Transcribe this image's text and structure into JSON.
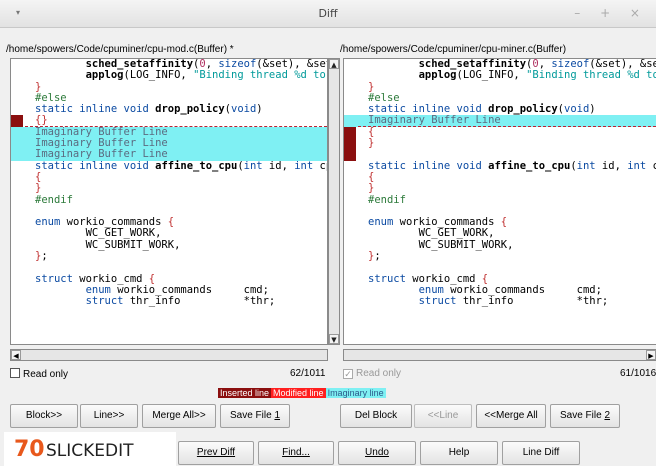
{
  "window": {
    "title": "Diff",
    "menu_glyph": "▾",
    "controls": "– + ×"
  },
  "left": {
    "path": "/home/spowers/Code/cpuminer/cpu-mod.c(Buffer) *",
    "status": "62/1011",
    "read_only_label": "Read only"
  },
  "right": {
    "path": "/home/spowers/Code/cpuminer/cpu-miner.c(Buffer)",
    "status": "61/1016",
    "read_only_label": "Read only"
  },
  "legend": {
    "inserted": "Inserted line",
    "modified": "Modified line",
    "imaginary": "Imaginary line"
  },
  "buttons_row1": {
    "block": "Block>>",
    "line": "Line>>",
    "merge_all": "Merge All>>",
    "save_file1_prefix": "Save File ",
    "save_file1_key": "1",
    "del_block": "Del Block",
    "line_back": "<<Line",
    "merge_all_back": "<<Merge All",
    "save_file2_prefix": "Save File ",
    "save_file2_key": "2"
  },
  "buttons_row2": {
    "prev_diff": "Prev Diff",
    "find": "Find...",
    "undo": "Undo",
    "help": "Help",
    "line_diff": "Line Diff"
  },
  "logo": {
    "number": "70",
    "name": "SLICKEDIT"
  },
  "colors": {
    "inserted": "#8b0f0f",
    "modified": "#ff1f1f",
    "imaginary": "#7ff0f3"
  }
}
